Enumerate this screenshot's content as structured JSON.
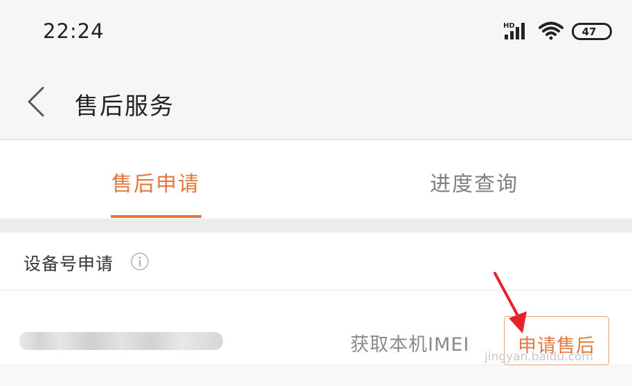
{
  "status_bar": {
    "time": "22:24",
    "network_label": "HD",
    "battery_level": "47",
    "icons": [
      "signal-icon",
      "wifi-icon",
      "battery-icon"
    ]
  },
  "header": {
    "title": "售后服务",
    "back_icon": "chevron-left-icon"
  },
  "tabs": [
    {
      "label": "售后申请",
      "active": true
    },
    {
      "label": "进度查询",
      "active": false
    }
  ],
  "section": {
    "title": "设备号申请",
    "info_icon": "info-icon"
  },
  "imei_row": {
    "get_imei_label": "获取本机IMEI",
    "apply_button_label": "申请售后"
  },
  "watermark": "jingyan.baidu.com",
  "colors": {
    "accent": "#e3783c",
    "annotation_arrow": "#e8202a",
    "background": "#f2f2f2"
  }
}
